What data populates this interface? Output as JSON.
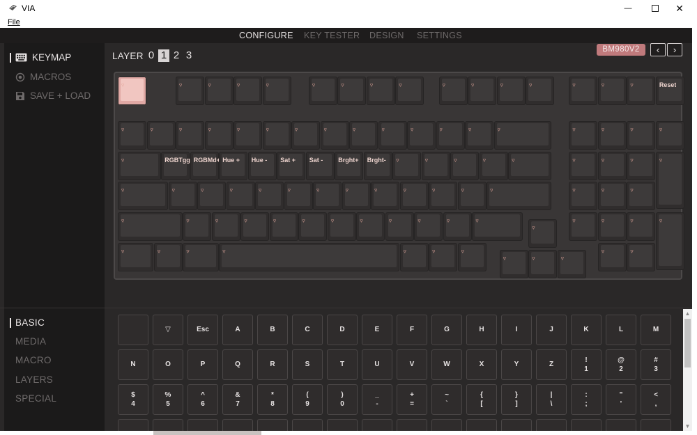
{
  "window": {
    "title": "VIA",
    "menu": [
      "File"
    ],
    "controls": {
      "minimize": "—",
      "close": "✕"
    }
  },
  "nav": {
    "tabs": [
      {
        "label": "CONFIGURE",
        "active": true
      },
      {
        "label": "KEY TESTER",
        "active": false
      },
      {
        "label": "DESIGN",
        "active": false
      },
      {
        "label": "SETTINGS",
        "active": false
      }
    ]
  },
  "sidebar": {
    "items": [
      {
        "label": "KEYMAP",
        "icon": "keyboard-icon",
        "active": true
      },
      {
        "label": "MACROS",
        "icon": "record-icon",
        "active": false
      },
      {
        "label": "SAVE + LOAD",
        "icon": "floppy-icon",
        "active": false
      }
    ]
  },
  "layers": {
    "label": "LAYER",
    "options": [
      "0",
      "1",
      "2",
      "3"
    ],
    "selected": "1"
  },
  "device": {
    "name": "BM980V2",
    "prev": "‹",
    "next": "›"
  },
  "keymap": {
    "transparent_glyph": "▿",
    "labels": {
      "reset": "Reset",
      "rgb_toggle": "RGBTgg",
      "rgb_mode": "RGBMd+",
      "hue_up": "Hue +",
      "hue_down": "Hue -",
      "sat_up": "Sat +",
      "sat_down": "Sat -",
      "bright_up": "Brght+",
      "bright_down": "Brght-"
    }
  },
  "categories": {
    "items": [
      {
        "label": "BASIC",
        "active": true
      },
      {
        "label": "MEDIA",
        "active": false
      },
      {
        "label": "MACRO",
        "active": false
      },
      {
        "label": "LAYERS",
        "active": false
      },
      {
        "label": "SPECIAL",
        "active": false
      }
    ]
  },
  "palette": {
    "rows": [
      [
        [
          ""
        ],
        [
          "▽"
        ],
        [
          "Esc"
        ],
        [
          "A"
        ],
        [
          "B"
        ],
        [
          "C"
        ],
        [
          "D"
        ],
        [
          "E"
        ],
        [
          "F"
        ],
        [
          "G"
        ],
        [
          "H"
        ],
        [
          "I"
        ],
        [
          "J"
        ],
        [
          "K"
        ],
        [
          "L"
        ],
        [
          "M"
        ]
      ],
      [
        [
          "N"
        ],
        [
          "O"
        ],
        [
          "P"
        ],
        [
          "Q"
        ],
        [
          "R"
        ],
        [
          "S"
        ],
        [
          "T"
        ],
        [
          "U"
        ],
        [
          "V"
        ],
        [
          "W"
        ],
        [
          "X"
        ],
        [
          "Y"
        ],
        [
          "Z"
        ],
        [
          "!",
          "1"
        ],
        [
          "@",
          "2"
        ],
        [
          "#",
          "3"
        ]
      ],
      [
        [
          "$",
          "4"
        ],
        [
          "%",
          "5"
        ],
        [
          "^",
          "6"
        ],
        [
          "&",
          "7"
        ],
        [
          "*",
          "8"
        ],
        [
          "(",
          "9"
        ],
        [
          ")",
          "0"
        ],
        [
          "_",
          "-"
        ],
        [
          "+",
          "="
        ],
        [
          "~",
          "`"
        ],
        [
          "{",
          "["
        ],
        [
          "}",
          "]"
        ],
        [
          "|",
          "\\"
        ],
        [
          ":",
          ";"
        ],
        [
          "\"",
          "'"
        ],
        [
          "<",
          ","
        ]
      ],
      [
        [
          ">"
        ],
        [
          "?"
        ],
        [
          ""
        ],
        [
          ""
        ],
        [
          ""
        ],
        [
          ""
        ],
        [
          ""
        ],
        [
          ""
        ],
        [
          ""
        ],
        [
          ""
        ],
        [
          ""
        ],
        [
          ""
        ],
        [
          ""
        ],
        [
          ""
        ],
        [
          ""
        ],
        [
          ""
        ]
      ]
    ]
  },
  "colors": {
    "background": "#2a2828",
    "sidebar": "#1b1a1a",
    "accent_key": "#f1c6c1",
    "key_label": "#e3a79b",
    "badge": "#c07a7c"
  }
}
